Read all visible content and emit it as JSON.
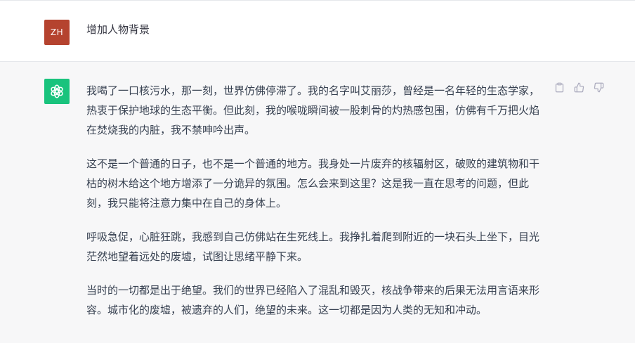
{
  "user_message": {
    "avatar_initials": "ZH",
    "text": "增加人物背景"
  },
  "assistant_message": {
    "paragraphs": [
      "我喝了一口核污水，那一刻，世界仿佛停滞了。我的名字叫艾丽莎，曾经是一名年轻的生态学家，热衷于保护地球的生态平衡。但此刻，我的喉咙瞬间被一股刺骨的灼热感包围，仿佛有千万把火焰在焚烧我的内脏，我不禁呻吟出声。",
      "这不是一个普通的日子，也不是一个普通的地方。我身处一片废弃的核辐射区，破败的建筑物和干枯的树木给这个地方增添了一分诡异的氛围。怎么会来到这里？这是我一直在思考的问题，但此刻，我只能将注意力集中在自己的身体上。",
      "呼吸急促，心脏狂跳，我感到自己仿佛站在生死线上。我挣扎着爬到附近的一块石头上坐下，目光茫然地望着远处的废墟，试图让思绪平静下来。",
      "当时的一切都是出于绝望。我们的世界已经陷入了混乱和毁灭，核战争带来的后果无法用言语来形容。城市化的废墟，被遗弃的人们，绝望的未来。这一切都是因为人类的无知和冲动。"
    ]
  },
  "icons": {
    "copy": "clipboard-icon",
    "like": "thumbs-up-icon",
    "dislike": "thumbs-down-icon",
    "assistant_logo": "openai-logo-icon"
  },
  "colors": {
    "user_avatar_bg": "#b5432f",
    "assistant_avatar_bg": "#19c37d",
    "assistant_row_bg": "#f7f7f8"
  }
}
